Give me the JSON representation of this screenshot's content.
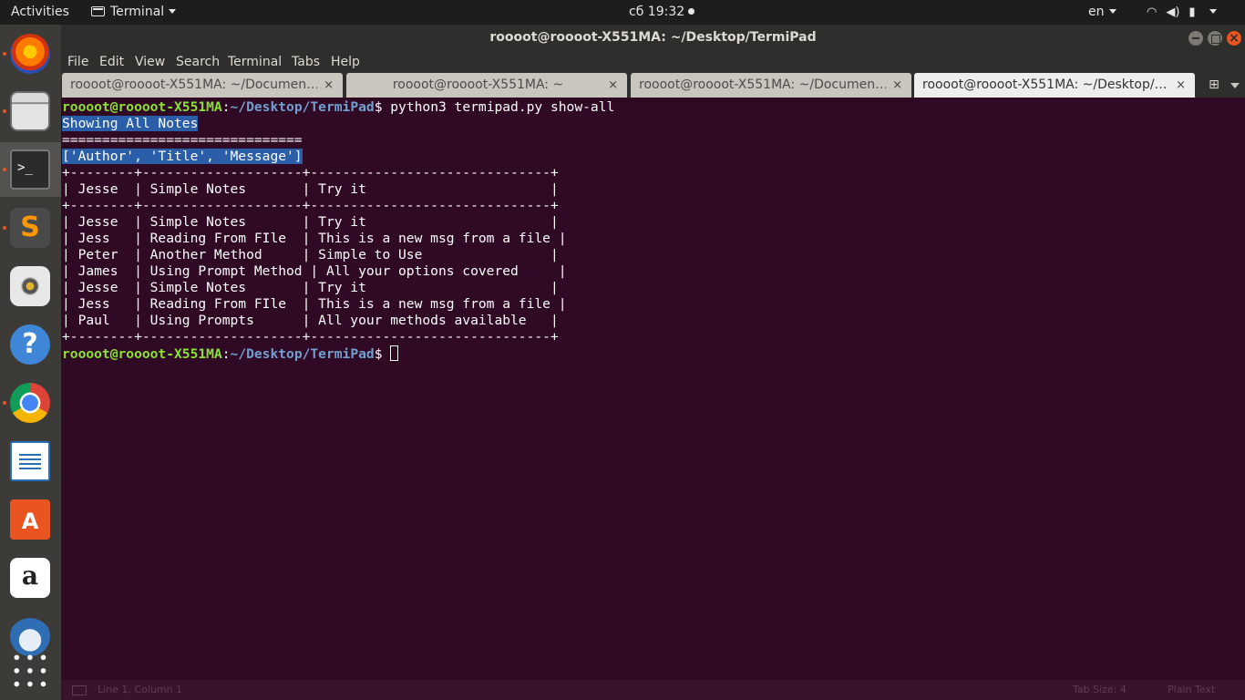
{
  "topbar": {
    "activities": "Activities",
    "app_menu": "Terminal",
    "clock": "сб 19:32",
    "language": "en"
  },
  "dock": {
    "items": [
      "firefox-icon",
      "files-icon",
      "terminal-icon",
      "sublime-text-icon",
      "speaker-icon",
      "help-icon",
      "chrome-icon",
      "libreoffice-writer-icon",
      "software-center-icon",
      "amazon-icon",
      "thunderbird-icon",
      "show-applications-icon"
    ]
  },
  "window": {
    "title": "roooot@roooot-X551MA: ~/Desktop/TermiPad"
  },
  "menu": {
    "file": "File",
    "edit": "Edit",
    "view": "View",
    "search": "Search",
    "terminal": "Terminal",
    "tabs": "Tabs",
    "help": "Help"
  },
  "tabs": [
    {
      "label": "roooot@roooot-X551MA: ~/Documen…",
      "close": "×"
    },
    {
      "label": "roooot@roooot-X551MA: ~",
      "close": "×"
    },
    {
      "label": "roooot@roooot-X551MA: ~/Documen…",
      "close": "×"
    },
    {
      "label": "roooot@roooot-X551MA: ~/Desktop/…",
      "close": "×"
    }
  ],
  "terminal": {
    "prompt_user": "roooot@roooot-X551MA",
    "prompt_sep": ":",
    "prompt_path": "~/Desktop/TermiPad",
    "prompt_dollar": "$ ",
    "command": "python3 termipad.py show-all",
    "lines": {
      "showing": "Showing All Notes",
      "rule": "==============================",
      "header": "['Author', 'Title', 'Message']",
      "border": "+--------+--------------------+------------------------------+",
      "row0": "| Jesse  | Simple Notes       | Try it                       |",
      "row1": "| Jesse  | Simple Notes       | Try it                       |",
      "row2": "| Jess   | Reading From FIle  | This is a new msg from a file |",
      "row3": "| Peter  | Another Method     | Simple to Use                |",
      "row4": "| James  | Using Prompt Method | All your options covered     |",
      "row5": "| Jesse  | Simple Notes       | Try it                       |",
      "row6": "| Jess   | Reading From FIle  | This is a new msg from a file |",
      "row7": "| Paul   | Using Prompts      | All your methods available   |"
    }
  },
  "statusbar": {
    "position": "Line 1, Column 1",
    "tab_size": "Tab Size: 4",
    "mode": "Plain Text"
  },
  "colors": {
    "terminal_bg": "#300a24",
    "prompt_user": "#8ae234",
    "prompt_path": "#729fcf",
    "selection": "#2a5ea8",
    "accent": "#e95420"
  }
}
